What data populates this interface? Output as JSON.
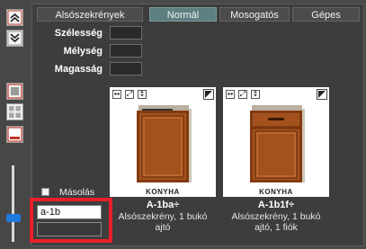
{
  "tabs": [
    {
      "label": "Alsószekrények",
      "active": false
    },
    {
      "label": "Normál",
      "active": true
    },
    {
      "label": "Mosogatós",
      "active": false
    },
    {
      "label": "Gépes",
      "active": false
    }
  ],
  "dimensions": {
    "width_label": "Szélesség",
    "depth_label": "Mélység",
    "height_label": "Magasság"
  },
  "products": [
    {
      "code": "A-1ba÷",
      "desc_line1": "Alsószekrény, 1 bukó",
      "desc_line2": "ajtó",
      "brand": "KONYHA",
      "body_color": "#a3521e"
    },
    {
      "code": "A-1b1f÷",
      "desc_line1": "Alsószekrény, 1 bukó",
      "desc_line2": "ajtó, 1 fiók",
      "brand": "KONYHA",
      "body_color": "#a3521e"
    }
  ],
  "copy": {
    "label": "Másolás",
    "name_value": "a-1b",
    "second_value": ""
  },
  "colors": {
    "accent": "#5e7f7f",
    "highlight": "#e8202a",
    "slider": "#1f7ae0"
  }
}
